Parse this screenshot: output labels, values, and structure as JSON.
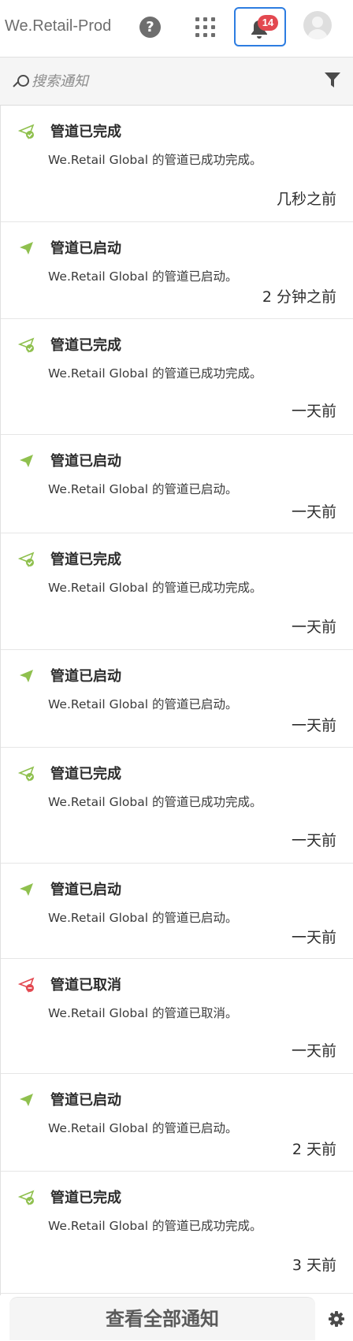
{
  "header": {
    "app_title": "We.Retail-Prod",
    "help_icon": "help-circle-icon",
    "apps_icon": "apps-grid-icon",
    "notifications_icon": "bell-icon",
    "notification_count": "14",
    "avatar_icon": "user-avatar-icon"
  },
  "search": {
    "placeholder": "搜索通知",
    "value": "",
    "filter_icon": "filter-icon"
  },
  "notifications": [
    {
      "title": "管道已完成",
      "description": "We.Retail Global 的管道已成功完成。",
      "time": "几秒之前",
      "icon": "pipeline-success-icon",
      "status_color": "#8fc04e"
    },
    {
      "title": "管道已启动",
      "description": "We.Retail Global 的管道已启动。",
      "time": "2 分钟之前",
      "icon": "pipeline-started-icon",
      "status_color": "#8fc04e"
    },
    {
      "title": "管道已完成",
      "description": "We.Retail Global 的管道已成功完成。",
      "time": "一天前",
      "icon": "pipeline-success-icon",
      "status_color": "#8fc04e"
    },
    {
      "title": "管道已启动",
      "description": "We.Retail Global 的管道已启动。",
      "time": "一天前",
      "icon": "pipeline-started-icon",
      "status_color": "#8fc04e"
    },
    {
      "title": "管道已完成",
      "description": "We.Retail Global 的管道已成功完成。",
      "time": "一天前",
      "icon": "pipeline-success-icon",
      "status_color": "#8fc04e"
    },
    {
      "title": "管道已启动",
      "description": "We.Retail Global 的管道已启动。",
      "time": "一天前",
      "icon": "pipeline-started-icon",
      "status_color": "#8fc04e"
    },
    {
      "title": "管道已完成",
      "description": "We.Retail Global 的管道已成功完成。",
      "time": "一天前",
      "icon": "pipeline-success-icon",
      "status_color": "#8fc04e"
    },
    {
      "title": "管道已启动",
      "description": "We.Retail Global 的管道已启动。",
      "time": "一天前",
      "icon": "pipeline-started-icon",
      "status_color": "#8fc04e"
    },
    {
      "title": "管道已取消",
      "description": "We.Retail Global 的管道已取消。",
      "time": "一天前",
      "icon": "pipeline-cancelled-icon",
      "status_color": "#e34850"
    },
    {
      "title": "管道已启动",
      "description": "We.Retail Global 的管道已启动。",
      "time": "2 天前",
      "icon": "pipeline-started-icon",
      "status_color": "#8fc04e"
    },
    {
      "title": "管道已完成",
      "description": "We.Retail Global 的管道已成功完成。",
      "time": "3 天前",
      "icon": "pipeline-success-icon",
      "status_color": "#8fc04e"
    }
  ],
  "footer": {
    "view_all_label": "查看全部通知",
    "settings_icon": "gear-icon"
  }
}
